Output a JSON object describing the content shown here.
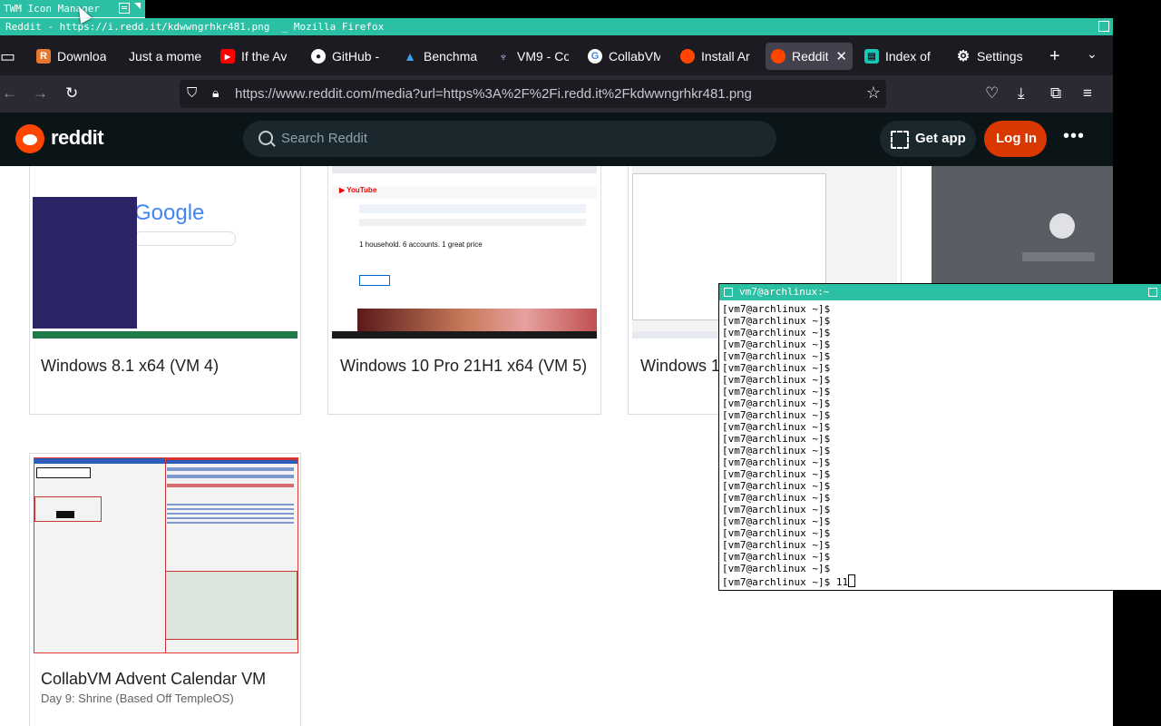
{
  "icon_manager": {
    "label": "TWM Icon Manager"
  },
  "firefox": {
    "title": "Reddit - https://i.redd.it/kdwwngrhkr481.png  _ Mozilla Firefox",
    "tabs": [
      {
        "label": "Downloa",
        "color": "#e7772e",
        "glyph": "R"
      },
      {
        "label": "Just a mome",
        "color": "#1c1b22",
        "glyph": ""
      },
      {
        "label": "If the Av",
        "color": "#ff0000",
        "glyph": "▶"
      },
      {
        "label": "GitHub -",
        "color": "#1c1b22",
        "glyph": "●"
      },
      {
        "label": "Benchma",
        "color": "#1c1b22",
        "glyph": "▲"
      },
      {
        "label": "VM9 - Co",
        "color": "#1c1b22",
        "glyph": "♆"
      },
      {
        "label": "CollabVM",
        "color": "#ffffff",
        "glyph": "G"
      },
      {
        "label": "Install Ar",
        "color": "#ff4500",
        "glyph": "●"
      },
      {
        "label": "Reddit",
        "color": "#ff4500",
        "glyph": "●",
        "active": true
      },
      {
        "label": "Index of",
        "color": "#1c1b22",
        "glyph": "▤"
      },
      {
        "label": "Settings",
        "color": "#1c1b22",
        "glyph": "⚙"
      }
    ],
    "url": "https://www.reddit.com/media?url=https%3A%2F%2Fi.redd.it%2Fkdwwngrhkr481.png"
  },
  "reddit": {
    "wordmark": "reddit",
    "search_placeholder": "Search Reddit",
    "get_app": "Get app",
    "login": "Log In"
  },
  "cards": [
    {
      "title": "Windows 8.1 x64 (VM 4)",
      "subtitle": ""
    },
    {
      "title": "Windows 10 Pro 21H1 x64 (VM 5)",
      "subtitle": ""
    },
    {
      "title": "Windows 1",
      "subtitle": ""
    },
    {
      "title": "CollabVM Advent Calendar VM",
      "subtitle": "Day 9: Shrine (Based Off TempleOS)"
    }
  ],
  "xterm": {
    "title": "vm7@archlinux:~",
    "lines": [
      "[vm7@archlinux ~]$",
      "[vm7@archlinux ~]$",
      "[vm7@archlinux ~]$",
      "[vm7@archlinux ~]$",
      "[vm7@archlinux ~]$",
      "[vm7@archlinux ~]$",
      "[vm7@archlinux ~]$",
      "[vm7@archlinux ~]$",
      "[vm7@archlinux ~]$",
      "[vm7@archlinux ~]$",
      "[vm7@archlinux ~]$",
      "[vm7@archlinux ~]$",
      "[vm7@archlinux ~]$",
      "[vm7@archlinux ~]$",
      "[vm7@archlinux ~]$",
      "[vm7@archlinux ~]$",
      "[vm7@archlinux ~]$",
      "[vm7@archlinux ~]$",
      "[vm7@archlinux ~]$",
      "[vm7@archlinux ~]$",
      "[vm7@archlinux ~]$",
      "[vm7@archlinux ~]$",
      "[vm7@archlinux ~]$"
    ],
    "prompt": "[vm7@archlinux ~]$ ",
    "input": "11"
  }
}
